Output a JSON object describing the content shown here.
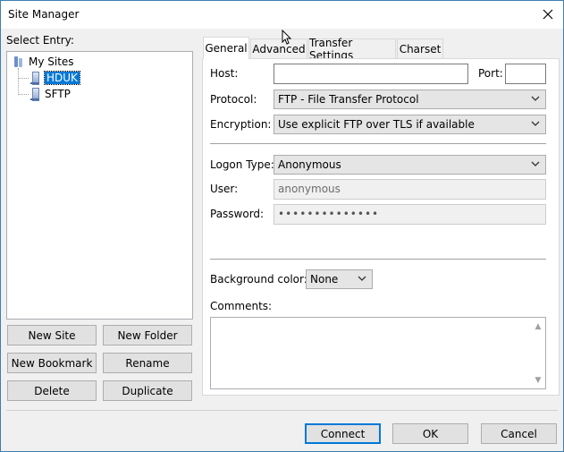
{
  "window": {
    "title": "Site Manager"
  },
  "tree": {
    "label": "Select Entry:",
    "root": "My Sites",
    "items": [
      {
        "label": "HDUK",
        "selected": true
      },
      {
        "label": "SFTP",
        "selected": false
      }
    ]
  },
  "left_buttons": {
    "new_site": "New Site",
    "new_folder": "New Folder",
    "new_bookmark": "New Bookmark",
    "rename": "Rename",
    "delete": "Delete",
    "duplicate": "Duplicate"
  },
  "tabs": [
    "General",
    "Advanced",
    "Transfer Settings",
    "Charset"
  ],
  "general": {
    "host_label": "Host:",
    "host_value": "",
    "port_label": "Port:",
    "port_value": "",
    "protocol_label": "Protocol:",
    "protocol_value": "FTP - File Transfer Protocol",
    "encryption_label": "Encryption:",
    "encryption_value": "Use explicit FTP over TLS if available",
    "logon_label": "Logon Type:",
    "logon_value": "Anonymous",
    "user_label": "User:",
    "user_value": "anonymous",
    "password_label": "Password:",
    "password_value": "••••••••••••••",
    "bgcolor_label": "Background color:",
    "bgcolor_value": "None",
    "comments_label": "Comments:",
    "comments_value": ""
  },
  "footer": {
    "connect": "Connect",
    "ok": "OK",
    "cancel": "Cancel"
  },
  "icons": {
    "close": "close-icon",
    "folder": "folder-icon",
    "server": "server-icon",
    "chevron": "chevron-down-icon",
    "cursor": "mouse-cursor-icon"
  },
  "colors": {
    "selection": "#0078d7",
    "window_bg": "#f0f0f0",
    "border": "#3c7fb1"
  }
}
